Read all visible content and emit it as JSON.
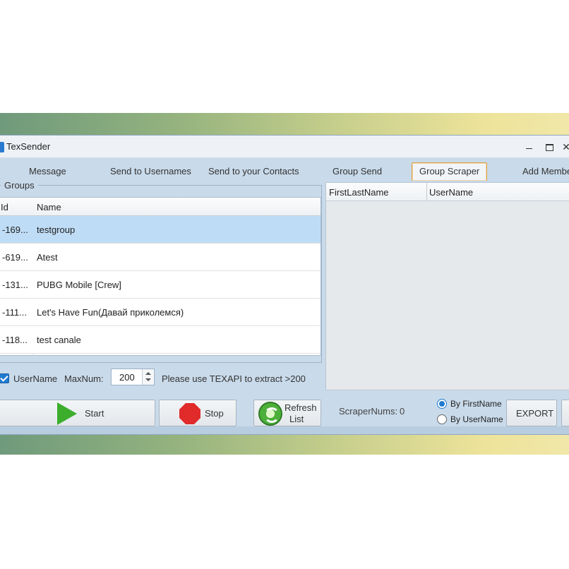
{
  "window": {
    "title": "TexSender",
    "close_glyph": "✕"
  },
  "tabs": [
    {
      "label": "Message"
    },
    {
      "label": "Send to Usernames"
    },
    {
      "label": "Send to your Contacts"
    },
    {
      "label": "Group Send"
    },
    {
      "label": "Group Scraper",
      "active": true
    },
    {
      "label": "Add Members"
    }
  ],
  "groups": {
    "legend": "Groups",
    "columns": [
      "Id",
      "Name"
    ],
    "rows": [
      {
        "id": "-169...",
        "name": "testgroup",
        "selected": true
      },
      {
        "id": "-619...",
        "name": "Atest"
      },
      {
        "id": "-131...",
        "name": "PUBG Mobile [Crew]"
      },
      {
        "id": "-111...",
        "name": "Let's Have Fun(Давай приколемся)"
      },
      {
        "id": "-118...",
        "name": "test canale"
      }
    ]
  },
  "options": {
    "username_checkbox_label": "UserName",
    "username_checked": true,
    "maxnum_label": "MaxNum:",
    "maxnum_value": "200",
    "hint": "Please use TEXAPI to extract >200"
  },
  "buttons": {
    "start": "Start",
    "stop": "Stop",
    "refresh_line1": "Refresh",
    "refresh_line2": "List",
    "export": "EXPORT"
  },
  "results": {
    "columns": [
      "FirstLastName",
      "UserName"
    ]
  },
  "scraper": {
    "label": "ScraperNums:",
    "count": "0",
    "radio_firstname": "By FirstName",
    "radio_username": "By UserName",
    "selected": "By FirstName"
  },
  "colors": {
    "accent": "#1f7ad0",
    "selected_row": "#bfdcf6",
    "window_bg": "#c9daea",
    "active_tab_border": "#d9a24a"
  },
  "icons": {
    "start": "play-icon",
    "stop": "stop-icon",
    "refresh": "refresh-icon"
  }
}
